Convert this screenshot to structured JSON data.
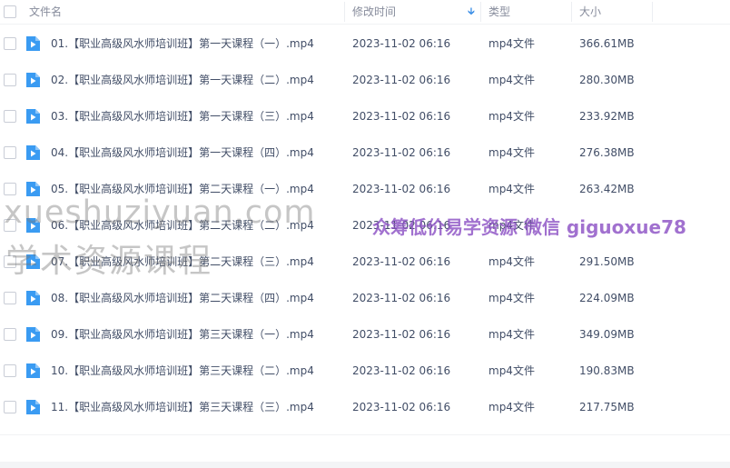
{
  "header": {
    "name_label": "文件名",
    "time_label": "修改时间",
    "type_label": "类型",
    "size_label": "大小",
    "sort_icon": "arrow-down-icon"
  },
  "files": [
    {
      "name": "01.【职业高级风水师培训班】第一天课程（一）.mp4",
      "modified": "2023-11-02 06:16",
      "type": "mp4文件",
      "size": "366.61MB"
    },
    {
      "name": "02.【职业高级风水师培训班】第一天课程（二）.mp4",
      "modified": "2023-11-02 06:16",
      "type": "mp4文件",
      "size": "280.30MB"
    },
    {
      "name": "03.【职业高级风水师培训班】第一天课程（三）.mp4",
      "modified": "2023-11-02 06:16",
      "type": "mp4文件",
      "size": "233.92MB"
    },
    {
      "name": "04.【职业高级风水师培训班】第一天课程（四）.mp4",
      "modified": "2023-11-02 06:16",
      "type": "mp4文件",
      "size": "276.38MB"
    },
    {
      "name": "05.【职业高级风水师培训班】第二天课程（一）.mp4",
      "modified": "2023-11-02 06:16",
      "type": "mp4文件",
      "size": "263.42MB"
    },
    {
      "name": "06.【职业高级风水师培训班】第二天课程（二）.mp4",
      "modified": "2023-11-02 06:16",
      "type": "mp4文件",
      "size": ""
    },
    {
      "name": "07.【职业高级风水师培训班】第二天课程（三）.mp4",
      "modified": "2023-11-02 06:16",
      "type": "mp4文件",
      "size": "291.50MB"
    },
    {
      "name": "08.【职业高级风水师培训班】第二天课程（四）.mp4",
      "modified": "2023-11-02 06:16",
      "type": "mp4文件",
      "size": "224.09MB"
    },
    {
      "name": "09.【职业高级风水师培训班】第三天课程（一）.mp4",
      "modified": "2023-11-02 06:16",
      "type": "mp4文件",
      "size": "349.09MB"
    },
    {
      "name": "10.【职业高级风水师培训班】第三天课程（二）.mp4",
      "modified": "2023-11-02 06:16",
      "type": "mp4文件",
      "size": "190.83MB"
    },
    {
      "name": "11.【职业高级风水师培训班】第三天课程（三）.mp4",
      "modified": "2023-11-02 06:16",
      "type": "mp4文件",
      "size": "217.75MB"
    }
  ],
  "file_icon": "video-file-icon",
  "watermarks": {
    "site": "xueshuziyuan.com",
    "site_cn": "学术资源课程",
    "promo": "众筹低价易学资源  微信 giguoxue78"
  },
  "colors": {
    "icon_blue": "#3a9bf2",
    "promo_purple": "#8c52c4"
  }
}
